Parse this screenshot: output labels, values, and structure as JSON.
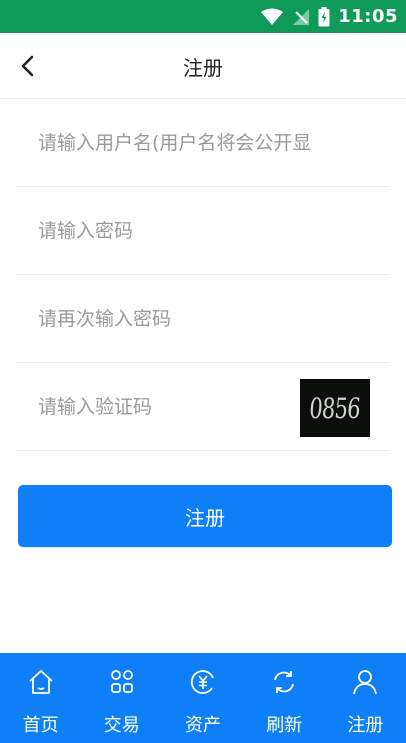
{
  "status_bar": {
    "time": "11:05",
    "icons": [
      "wifi-icon",
      "signal-icon",
      "battery-icon"
    ],
    "background": "#0f9b57"
  },
  "header": {
    "title": "注册",
    "back_icon": "chevron-left-icon"
  },
  "form": {
    "username_placeholder": "请输入用户名(用户名将会公开显",
    "password_placeholder": "请输入密码",
    "confirm_password_placeholder": "请再次输入密码",
    "captcha_placeholder": "请输入验证码",
    "captcha_text": "0856",
    "submit_label": "注册"
  },
  "tabbar": {
    "background": "#0f7ff7",
    "items": [
      {
        "label": "首页",
        "icon": "home-icon"
      },
      {
        "label": "交易",
        "icon": "grid-icon"
      },
      {
        "label": "资产",
        "icon": "yen-coin-icon"
      },
      {
        "label": "刷新",
        "icon": "refresh-icon"
      },
      {
        "label": "注册",
        "icon": "user-icon"
      }
    ]
  }
}
